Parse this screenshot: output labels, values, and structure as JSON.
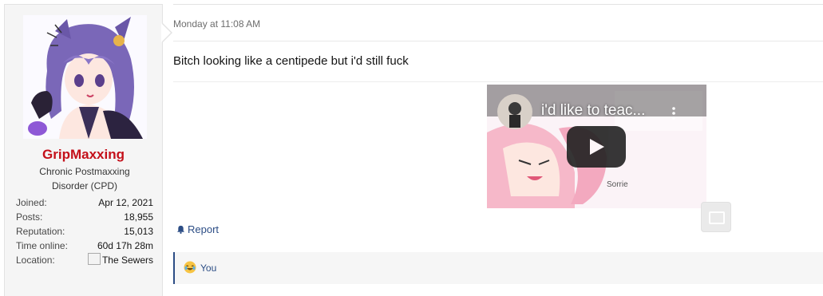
{
  "post": {
    "author": {
      "username": "GripMaxxing",
      "title": "Chronic Postmaxxing Disorder (CPD)",
      "stats": [
        {
          "label": "Joined:",
          "value": "Apr 12, 2021"
        },
        {
          "label": "Posts:",
          "value": "18,955"
        },
        {
          "label": "Reputation:",
          "value": "15,013"
        },
        {
          "label": "Time online:",
          "value": "60d 17h 28m"
        }
      ],
      "location_label": "Location:",
      "location_value": "The Sewers"
    },
    "date": "Monday at 11:08 AM",
    "content": "Bitch looking like a centipede but i'd still fuck",
    "video": {
      "title": "i'd like to teac..."
    },
    "actions": {
      "report_label": "Report"
    },
    "reactions": {
      "users": "You"
    }
  },
  "colors": {
    "username": "#c4101a",
    "link": "#2c4d85",
    "sidebar_bg": "#f5f5f5"
  }
}
